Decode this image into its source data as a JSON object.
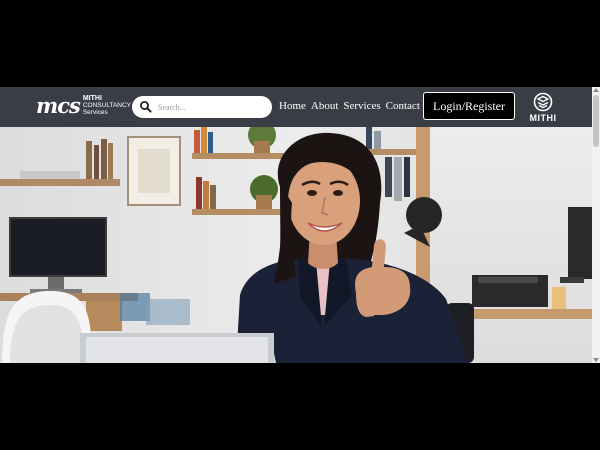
{
  "brand": {
    "mark": "mcs",
    "line1": "MITHI",
    "line2": "CONSULTANCY",
    "line3": "Services"
  },
  "search": {
    "placeholder": "Search..."
  },
  "nav": {
    "links": [
      "Home",
      "About",
      "Services",
      "Contact"
    ]
  },
  "login": {
    "label": "Login/Register"
  },
  "logo_right": {
    "text": "MITHI"
  },
  "colors": {
    "navbar": "#3a3d46",
    "page_letterbox": "#000000",
    "login_bg": "#000000",
    "jacket": "#1b2137"
  },
  "icons": [
    "search-icon",
    "mithi-emblem-icon"
  ]
}
